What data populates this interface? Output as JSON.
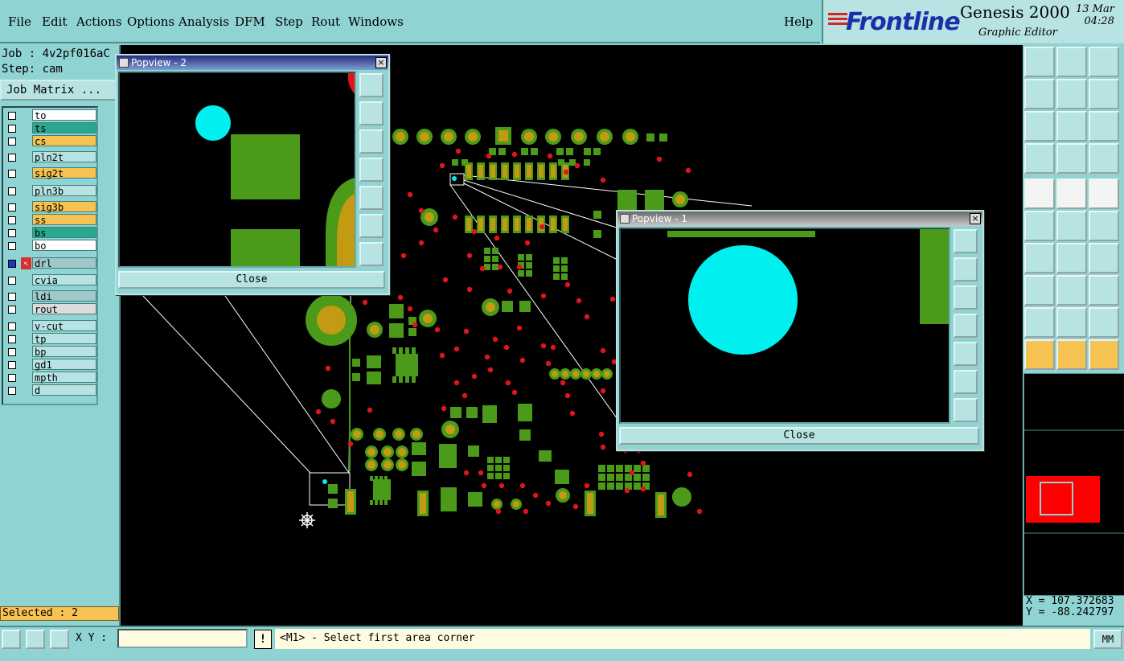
{
  "menu": {
    "items": [
      "File",
      "Edit",
      "Actions",
      "Options",
      "Analysis",
      "DFM",
      "Step",
      "Rout",
      "Windows"
    ],
    "help": "Help"
  },
  "brand": {
    "logo": "Frontline",
    "product": "Genesis 2000",
    "subtitle": "Graphic Editor",
    "date": "13 Mar",
    "time": "04:28"
  },
  "left_panel": {
    "job": "Job : 4v2pf016aC",
    "step": "Step: cam",
    "job_matrix": "Job Matrix ...",
    "layers": [
      {
        "name": "to",
        "color": "#ffffff",
        "mark": true
      },
      {
        "name": "ts",
        "color": "#2aa88e",
        "mark": true
      },
      {
        "name": "cs",
        "color": "#f6c252",
        "mark": true
      },
      {
        "name": "pln2t",
        "color": "#b7e3e2",
        "mark": false
      },
      {
        "name": "sig2t",
        "color": "#f6c252",
        "mark": true
      },
      {
        "name": "pln3b",
        "color": "#b7e3e2",
        "mark": false
      },
      {
        "name": "sig3b",
        "color": "#f6c252",
        "mark": true
      },
      {
        "name": "ss",
        "color": "#f6c252",
        "mark": true
      },
      {
        "name": "bs",
        "color": "#2aa88e",
        "mark": true
      },
      {
        "name": "bo",
        "color": "#ffffff",
        "mark": true
      },
      {
        "name": "drl",
        "color": "#9fc8c8",
        "mark": false,
        "active": true
      },
      {
        "name": "cvia",
        "color": "#b7e3e2",
        "mark": false
      },
      {
        "name": "ldi",
        "color": "#9fc8c8",
        "mark": false
      },
      {
        "name": "rout",
        "color": "#dcdcdc",
        "mark": false
      },
      {
        "name": "v-cut",
        "color": "#b7e3e2",
        "mark": false
      },
      {
        "name": "tp",
        "color": "#b7e3e2",
        "mark": false
      },
      {
        "name": "bp",
        "color": "#b7e3e2",
        "mark": false
      },
      {
        "name": "gd1",
        "color": "#b7e3e2",
        "mark": false
      },
      {
        "name": "mpth",
        "color": "#b7e3e2",
        "mark": false
      },
      {
        "name": "d",
        "color": "#b7e3e2",
        "mark": false
      }
    ],
    "selected": "Selected : 2"
  },
  "popview2": {
    "title": "Popview - 2",
    "close": "Close"
  },
  "popview1": {
    "title": "Popview - 1",
    "close": "Close"
  },
  "coords": {
    "x": "X = 107.372683",
    "y": "Y = -88.242797"
  },
  "bottom": {
    "xy_label": "X Y :",
    "xy_value": "",
    "warn": "!",
    "prompt": "<M1> - Select first area corner",
    "units": "MM"
  },
  "colors": {
    "board_green": "#4c9a1a",
    "pad_gold": "#c29b12",
    "drill_red": "#e0141a",
    "via_cyan": "#00f0f0"
  }
}
